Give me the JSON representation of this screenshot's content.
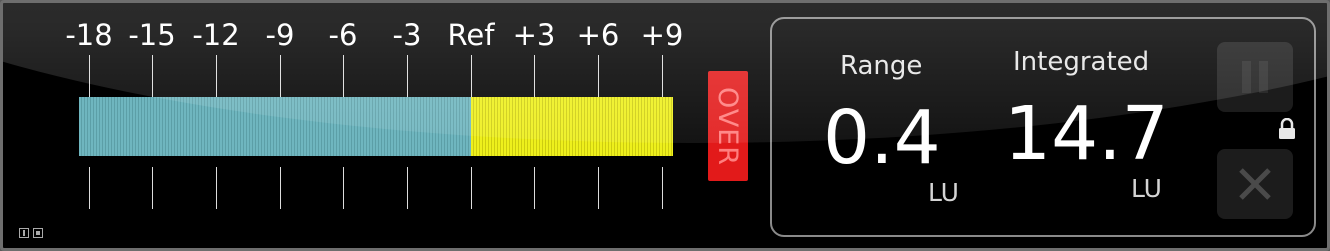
{
  "scale": {
    "labels": [
      "-18",
      "-15",
      "-12",
      "-9",
      "-6",
      "-3",
      "Ref",
      "+3",
      "+6",
      "+9"
    ]
  },
  "meter": {
    "fill_fraction": 1.0,
    "warn_fraction": 0.66,
    "colors": {
      "normal": "#6fb6bf",
      "warn": "#eef01c",
      "over": "#e21a1a"
    }
  },
  "over_indicator": {
    "label": "OVER"
  },
  "stats": {
    "range": {
      "label": "Range",
      "value": "0.4",
      "unit": "LU"
    },
    "integrated": {
      "label": "Integrated",
      "value": "14.7",
      "unit": "LU"
    }
  },
  "controls": {
    "pause": {
      "icon": "pause-icon"
    },
    "close": {
      "icon": "close-icon"
    },
    "lock": {
      "icon": "lock-icon"
    }
  }
}
